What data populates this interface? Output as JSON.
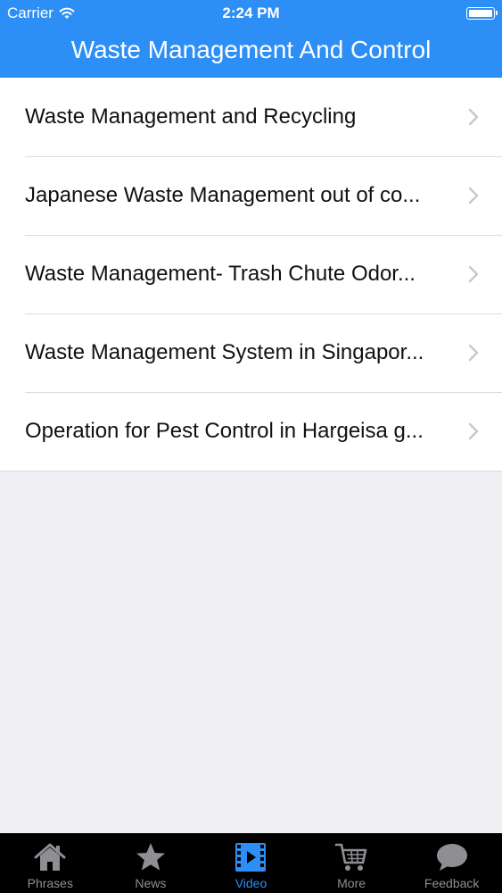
{
  "status_bar": {
    "carrier": "Carrier",
    "time": "2:24 PM"
  },
  "nav": {
    "title": "Waste Management And Control"
  },
  "videos": [
    {
      "title": "Waste Management and Recycling"
    },
    {
      "title": "Japanese Waste Management out of co..."
    },
    {
      "title": "Waste Management- Trash Chute Odor..."
    },
    {
      "title": "Waste Management System in Singapor..."
    },
    {
      "title": "Operation for Pest Control in Hargeisa g..."
    }
  ],
  "tabs": [
    {
      "label": "Phrases",
      "icon": "house-icon",
      "active": false
    },
    {
      "label": "News",
      "icon": "star-icon",
      "active": false
    },
    {
      "label": "Video",
      "icon": "film-icon",
      "active": true
    },
    {
      "label": "More",
      "icon": "cart-icon",
      "active": false
    },
    {
      "label": "Feedback",
      "icon": "speech-bubble-icon",
      "active": false
    }
  ],
  "colors": {
    "accent": "#2d8ef5",
    "background": "#efeff4",
    "tab_bar": "#000000",
    "tab_inactive": "#8e8e93"
  }
}
